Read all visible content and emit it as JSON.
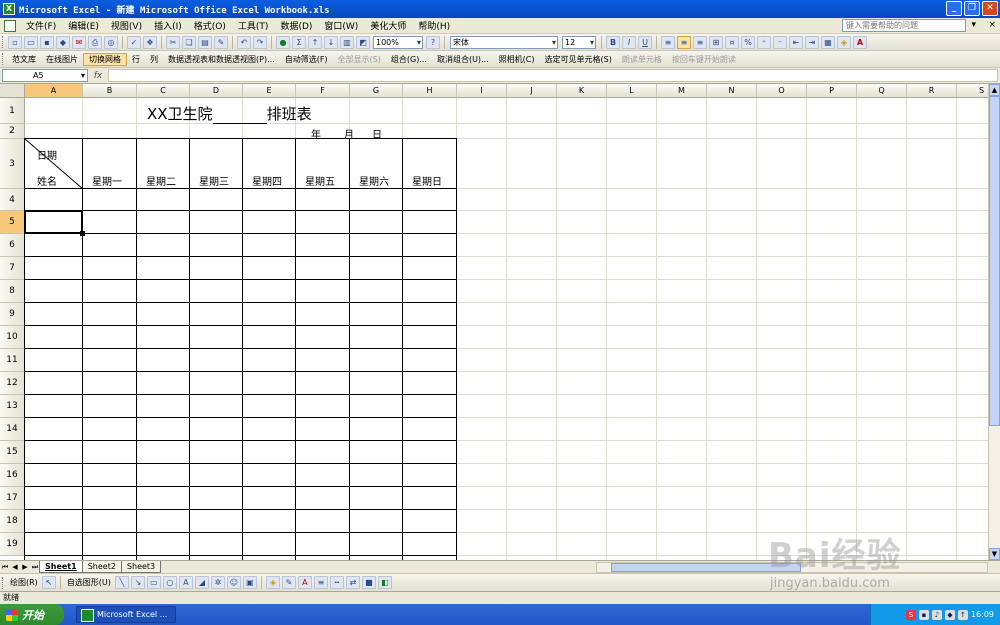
{
  "window": {
    "title": "Microsoft Excel - 新建 Microsoft Office Excel Workbook.xls",
    "app_icon_letter": "X",
    "minimize": "_",
    "restore": "❐",
    "close": "✕"
  },
  "menu": {
    "items": [
      "文件(F)",
      "编辑(E)",
      "视图(V)",
      "插入(I)",
      "格式(O)",
      "工具(T)",
      "数据(D)",
      "窗口(W)",
      "美化大师",
      "帮助(H)"
    ],
    "help_placeholder": "键入需要帮助的问题"
  },
  "standard_toolbar": {
    "zoom": "100%",
    "font_name": "宋体",
    "font_size": "12",
    "sum_icon": "Σ",
    "bold": "B",
    "italic": "I",
    "underline": "U",
    "percent": "%",
    "font_color_letter": "A"
  },
  "addin_toolbar": {
    "items": [
      {
        "label": "范文库",
        "state": "normal"
      },
      {
        "label": "在线图片",
        "state": "normal"
      },
      {
        "label": "切换网格",
        "state": "pressed"
      },
      {
        "label": "行",
        "state": "normal"
      },
      {
        "label": "列",
        "state": "normal"
      },
      {
        "label": "数据透视表和数据透视图(P)...",
        "state": "normal"
      },
      {
        "label": "自动筛选(F)",
        "state": "normal"
      },
      {
        "label": "全部显示(S)",
        "state": "dim"
      },
      {
        "label": "组合(G)...",
        "state": "normal"
      },
      {
        "label": "取消组合(U)...",
        "state": "normal"
      },
      {
        "label": "照相机(C)",
        "state": "normal"
      },
      {
        "label": "选定可见单元格(S)",
        "state": "normal"
      },
      {
        "label": "朗读单元格",
        "state": "dim"
      },
      {
        "label": "按回车键开始朗读",
        "state": "dim"
      }
    ]
  },
  "formula_bar": {
    "name_box": "A5",
    "fx": "fx",
    "formula": ""
  },
  "grid": {
    "columns": [
      "A",
      "B",
      "C",
      "D",
      "E",
      "F",
      "G",
      "H",
      "I",
      "J",
      "K",
      "L",
      "M",
      "N",
      "O",
      "P",
      "Q",
      "R",
      "S"
    ],
    "rows": [
      "1",
      "2",
      "3",
      "4",
      "5",
      "6",
      "7",
      "8",
      "9",
      "10",
      "11",
      "12",
      "13",
      "14",
      "15",
      "16",
      "17",
      "18",
      "19"
    ],
    "active_column": "A",
    "active_row": "5"
  },
  "sheet": {
    "title_prefix": "XX卫生院",
    "title_suffix": "排班表",
    "date_year": "年",
    "date_month": "月",
    "date_day": "日",
    "header_date": "日期",
    "header_name": "姓名",
    "weekdays": [
      "星期一",
      "星期二",
      "星期三",
      "星期四",
      "星期五",
      "星期六",
      "星期日"
    ]
  },
  "sheet_tabs": [
    "Sheet1",
    "Sheet2",
    "Sheet3"
  ],
  "drawing_toolbar": {
    "draw_label": "绘图(R)",
    "autoshape_label": "自选图形(U)"
  },
  "status": {
    "text": "就绪"
  },
  "taskbar": {
    "start": "开始",
    "task_item": "Microsoft Excel ...",
    "clock": "16:09"
  },
  "watermark": {
    "logo": "Bai经验",
    "url": "jingyan.baidu.com"
  }
}
